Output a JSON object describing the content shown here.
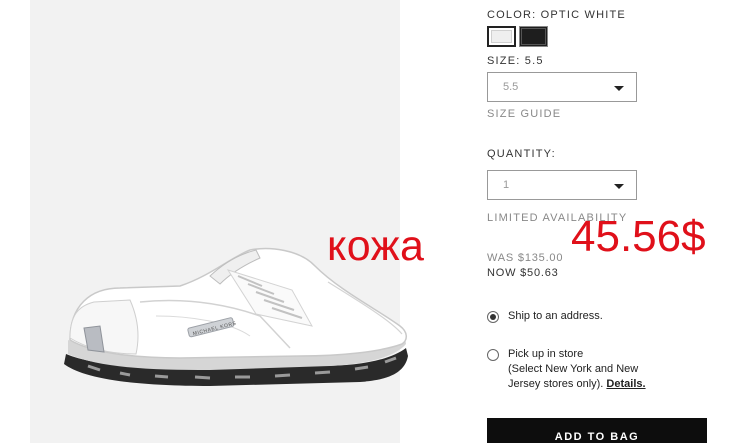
{
  "overlay": {
    "word": "кожа",
    "price": "45.56$"
  },
  "product": {
    "color_label": "COLOR: OPTIC WHITE",
    "swatches": [
      {
        "name": "optic-white",
        "color": "#efefef",
        "selected": true
      },
      {
        "name": "black",
        "color": "#1e1e1e",
        "selected": false
      }
    ],
    "size_label": "SIZE: 5.5",
    "size_value": "5.5",
    "size_guide": "SIZE GUIDE",
    "quantity_label": "QUANTITY:",
    "quantity_value": "1",
    "availability": "LIMITED AVAILABILITY",
    "price_was": "WAS $135.00",
    "price_now": "NOW $50.63",
    "shoe_badge_text": "MICHAEL KORS"
  },
  "delivery": {
    "ship_label": "Ship to an address.",
    "pickup_line1": "Pick up in store",
    "pickup_line2": "(Select New York and New",
    "pickup_line3": "Jersey stores only).",
    "details_label": "Details."
  },
  "cta": {
    "add_to_bag_label": "ADD TO BAG"
  },
  "colors": {
    "overlay_red": "#e0101a",
    "button_black": "#0d0d0d",
    "image_background": "#f2f2f2"
  }
}
